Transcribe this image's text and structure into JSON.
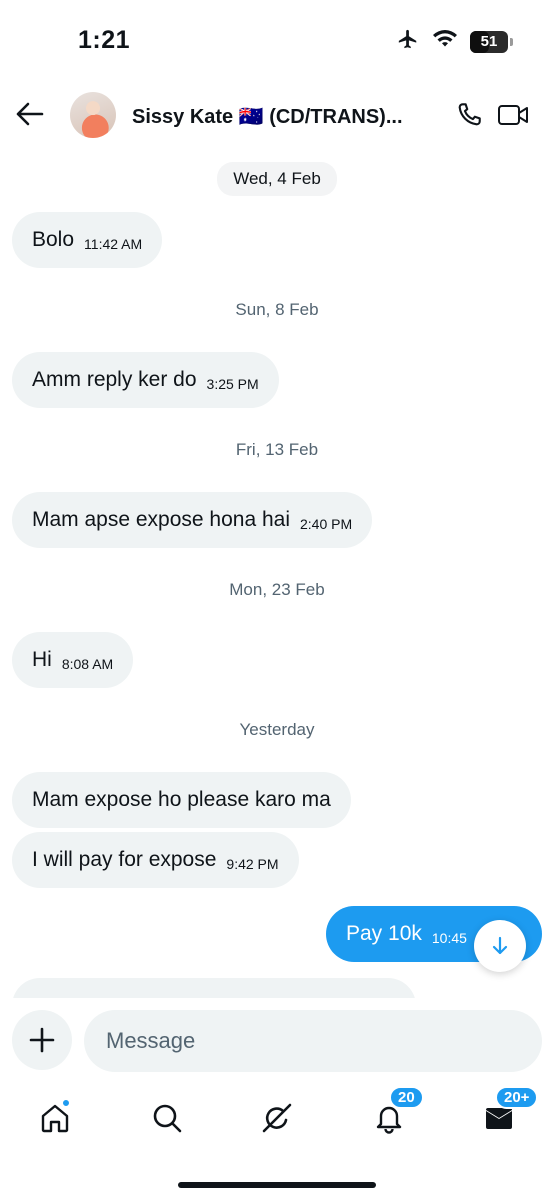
{
  "status_bar": {
    "time": "1:21",
    "battery_level": "51",
    "icons": [
      "airplane-icon",
      "wifi-icon",
      "battery-icon"
    ]
  },
  "header": {
    "contact_name": "Sissy Kate 🇦🇺 (CD/TRANS)...",
    "icons": [
      "back-arrow-icon",
      "phone-icon",
      "video-icon"
    ]
  },
  "messages": [
    {
      "type": "date",
      "label": "Wed, 4 Feb",
      "style": "pill"
    },
    {
      "type": "in",
      "text": "Bolo",
      "time": "11:42 AM"
    },
    {
      "type": "date",
      "label": "Sun, 8 Feb"
    },
    {
      "type": "in",
      "text": "Amm reply ker do",
      "time": "3:25 PM"
    },
    {
      "type": "date",
      "label": "Fri, 13 Feb"
    },
    {
      "type": "in",
      "text": "Mam apse expose hona hai",
      "time": "2:40 PM"
    },
    {
      "type": "date",
      "label": "Mon, 23 Feb"
    },
    {
      "type": "in",
      "text": "Hi",
      "time": "8:08 AM"
    },
    {
      "type": "date",
      "label": "Yesterday"
    },
    {
      "type": "in",
      "text": "Mam expose ho please karo ma",
      "time": ""
    },
    {
      "type": "in",
      "text": "I will pay for expose",
      "time": "9:42 PM"
    },
    {
      "type": "out",
      "text": "Pay 10k",
      "time": "10:45"
    }
  ],
  "composer": {
    "placeholder": "Message"
  },
  "bottom_nav": {
    "notifications_badge": "20",
    "messages_badge": "20+",
    "icons": [
      "home-icon",
      "search-icon",
      "grok-icon",
      "bell-icon",
      "mail-icon"
    ]
  },
  "colors": {
    "accent": "#1d9bf0",
    "bubble_in": "#eff3f4",
    "secondary_text": "#536471"
  }
}
